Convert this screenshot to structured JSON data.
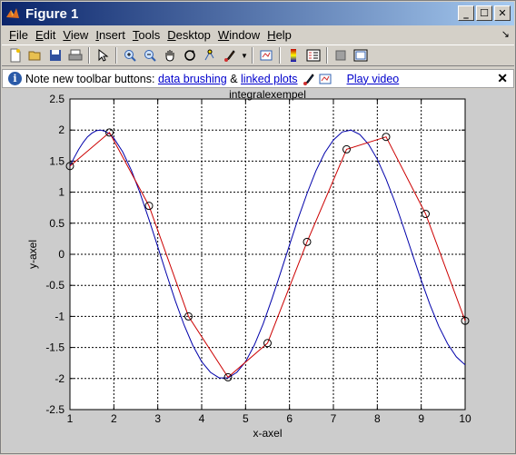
{
  "window": {
    "title": "Figure 1"
  },
  "menu": [
    {
      "label": "File",
      "u": "F",
      "rest": "ile"
    },
    {
      "label": "Edit",
      "u": "E",
      "rest": "dit"
    },
    {
      "label": "View",
      "u": "V",
      "rest": "iew"
    },
    {
      "label": "Insert",
      "u": "I",
      "rest": "nsert"
    },
    {
      "label": "Tools",
      "u": "T",
      "rest": "ools"
    },
    {
      "label": "Desktop",
      "u": "D",
      "rest": "esktop"
    },
    {
      "label": "Window",
      "u": "W",
      "rest": "indow"
    },
    {
      "label": "Help",
      "u": "H",
      "rest": "elp"
    }
  ],
  "infobar": {
    "text": "Note new toolbar buttons:",
    "link1": "data brushing",
    "amp": "&",
    "link2": "linked plots",
    "link3": "Play video"
  },
  "chart_data": {
    "type": "line",
    "title": "integralexempel",
    "xlabel": "x-axel",
    "ylabel": "y-axel",
    "xlim": [
      1,
      10
    ],
    "ylim": [
      -2.5,
      2.5
    ],
    "xticks": [
      1,
      2,
      3,
      4,
      5,
      6,
      7,
      8,
      9,
      10
    ],
    "yticks": [
      2.5,
      2,
      1.5,
      1,
      0.5,
      0,
      -0.5,
      -1,
      -1.5,
      -2,
      -2.5
    ],
    "grid": true,
    "series": [
      {
        "style": "smooth",
        "color": "#0000aa",
        "x": [
          1.0,
          1.1,
          1.2,
          1.3,
          1.4,
          1.5,
          1.6,
          1.7,
          1.8,
          1.9,
          2.0,
          2.2,
          2.4,
          2.6,
          2.8,
          3.0,
          3.2,
          3.4,
          3.6,
          3.8,
          4.0,
          4.2,
          4.4,
          4.6,
          4.8,
          5.0,
          5.2,
          5.4,
          5.6,
          5.8,
          6.0,
          6.2,
          6.4,
          6.6,
          6.8,
          7.0,
          7.2,
          7.4,
          7.6,
          7.8,
          8.0,
          8.2,
          8.4,
          8.6,
          8.8,
          9.0,
          9.2,
          9.4,
          9.6,
          9.8,
          10.0
        ],
        "y": [
          1.42,
          1.56,
          1.69,
          1.8,
          1.89,
          1.95,
          1.99,
          2.0,
          1.98,
          1.94,
          1.87,
          1.65,
          1.35,
          0.98,
          0.56,
          0.12,
          -0.32,
          -0.75,
          -1.14,
          -1.47,
          -1.73,
          -1.9,
          -1.99,
          -1.99,
          -1.9,
          -1.73,
          -1.46,
          -1.12,
          -0.72,
          -0.29,
          0.15,
          0.58,
          0.98,
          1.34,
          1.63,
          1.84,
          1.97,
          2.0,
          1.93,
          1.77,
          1.53,
          1.21,
          0.84,
          0.43,
          0.0,
          -0.42,
          -0.81,
          -1.16,
          -1.44,
          -1.65,
          -1.78
        ]
      },
      {
        "style": "markers",
        "color": "#cc0000",
        "x": [
          1.0,
          1.9,
          2.8,
          3.7,
          4.6,
          5.5,
          6.4,
          7.3,
          8.2,
          9.1,
          10.0
        ],
        "y": [
          1.42,
          1.96,
          0.78,
          -1.0,
          -1.98,
          -1.43,
          0.2,
          1.69,
          1.89,
          0.65,
          -1.07
        ]
      }
    ]
  }
}
